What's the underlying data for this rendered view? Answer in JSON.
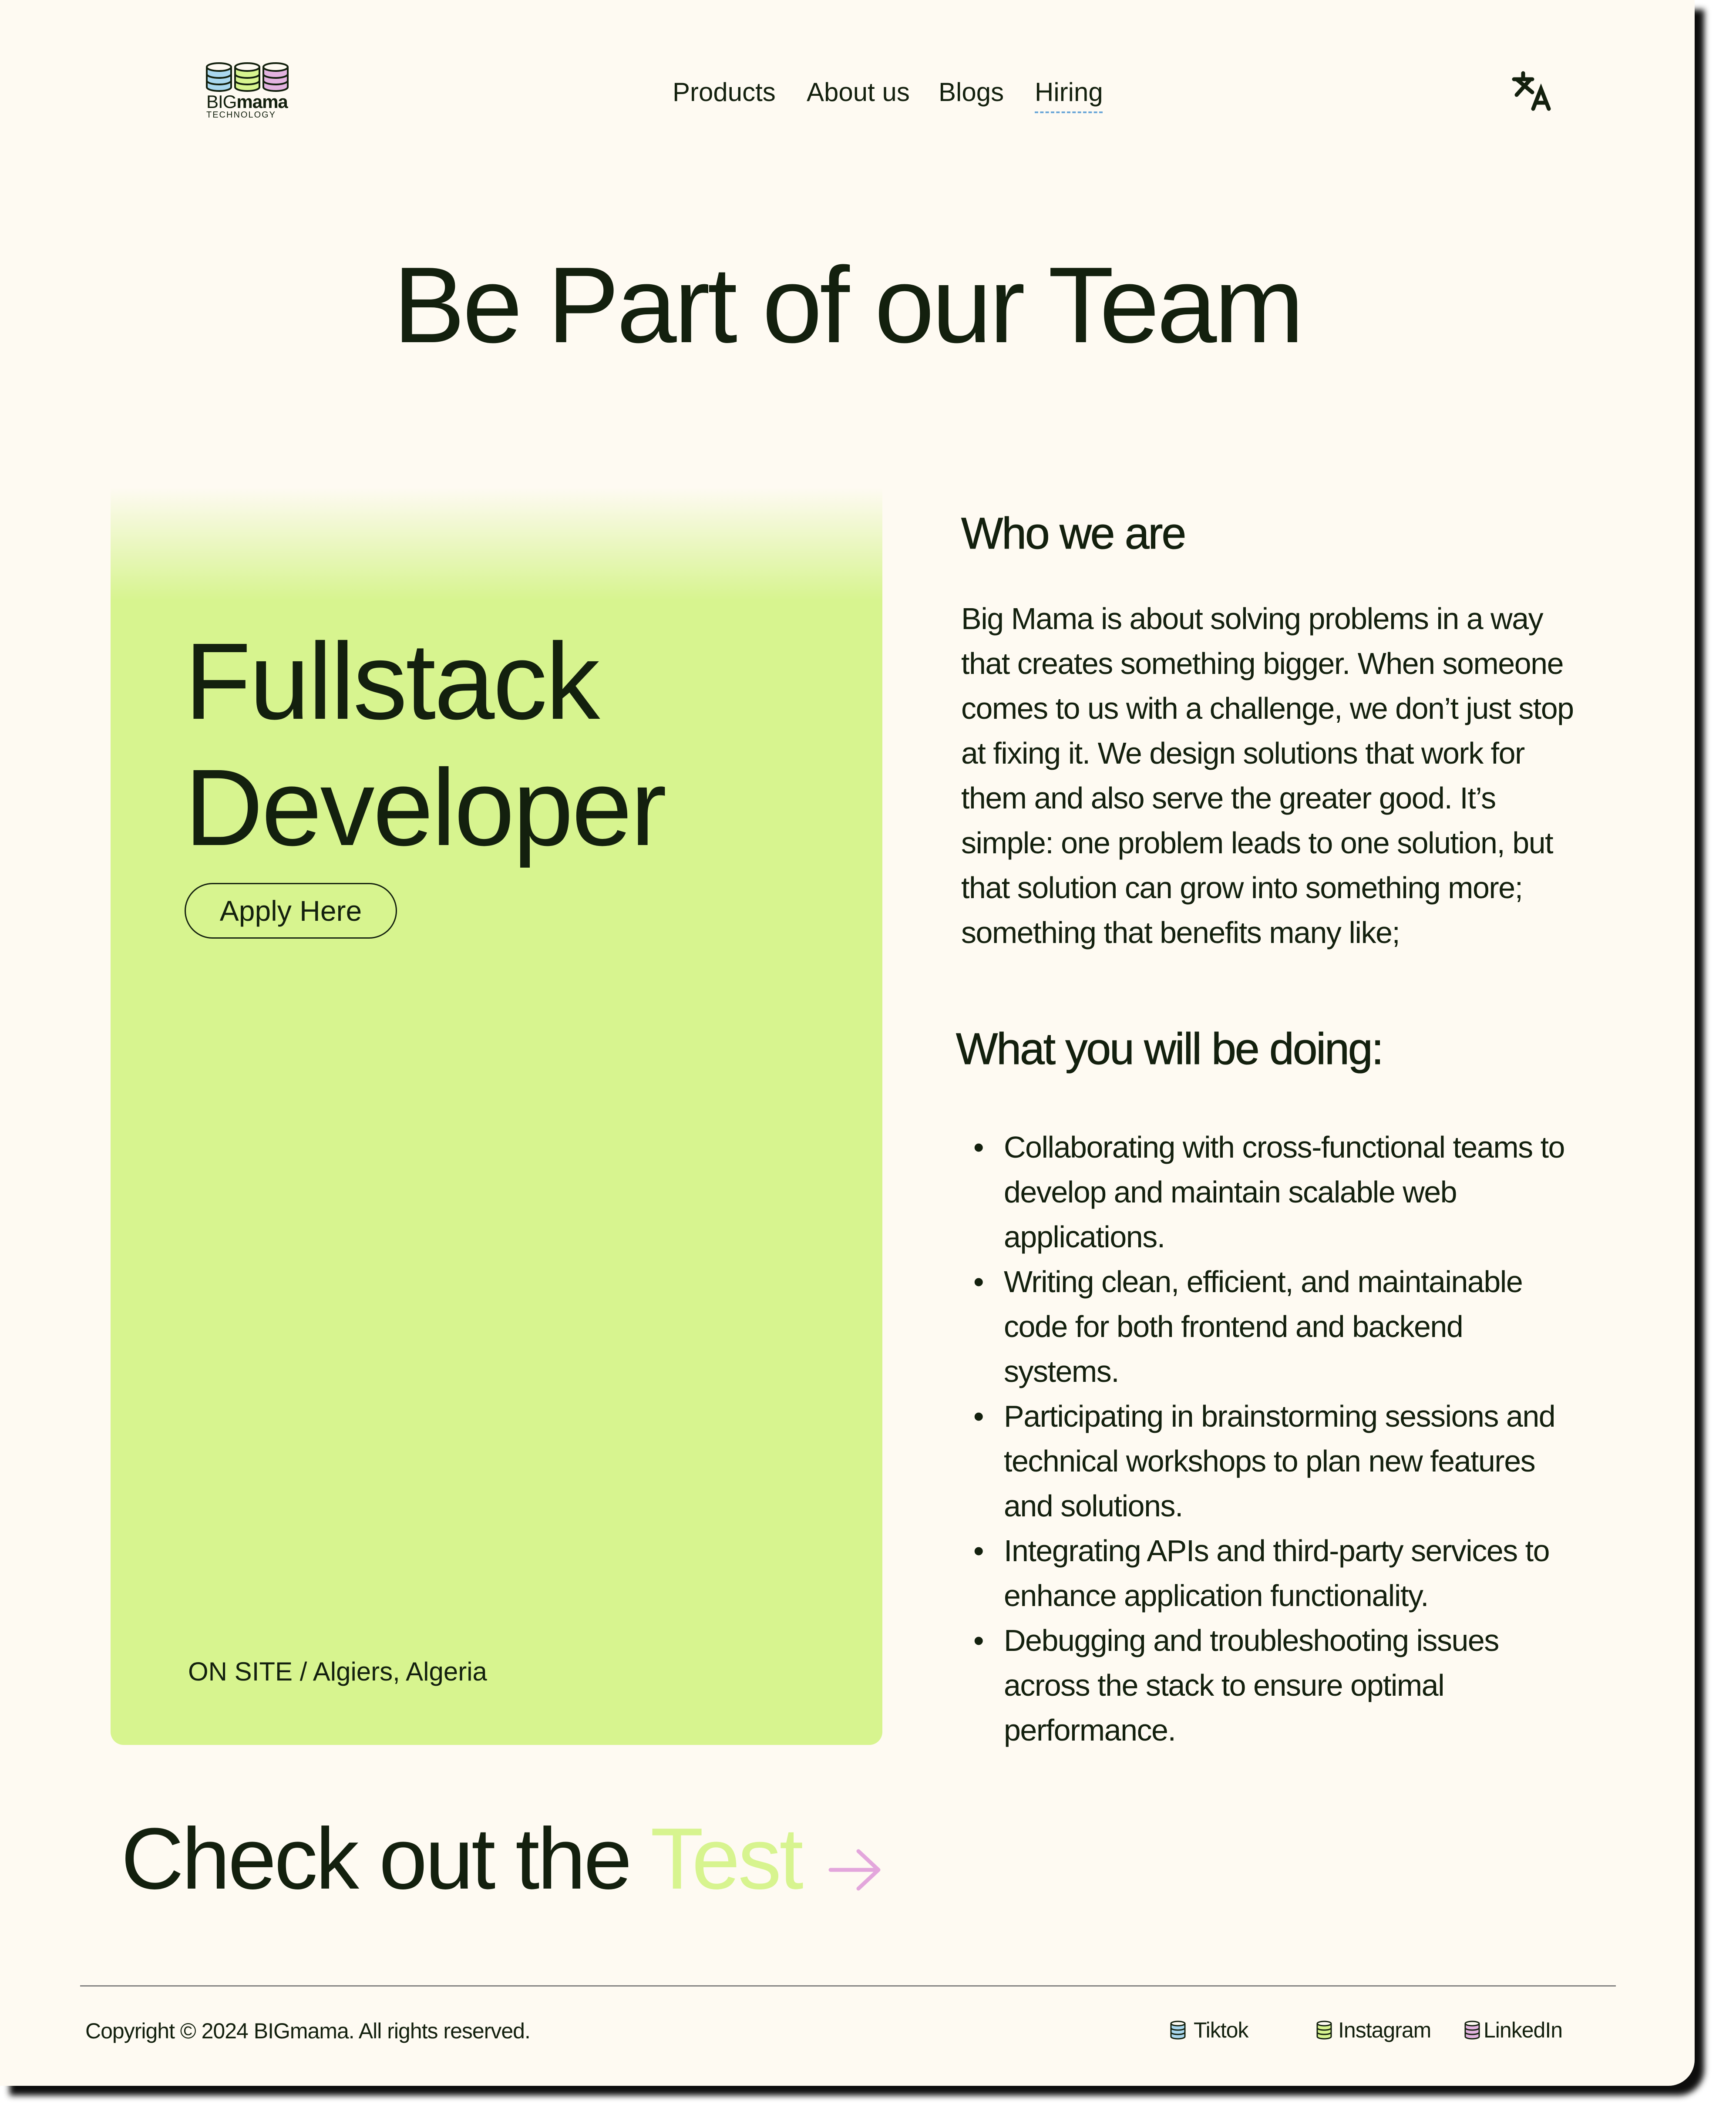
{
  "header": {
    "logo": {
      "brand_light": "BIG",
      "brand_bold": "mama",
      "subtitle": "TECHNOLOGY",
      "icon": "database-stack-logo-icon"
    },
    "nav": [
      {
        "label": "Products"
      },
      {
        "label": "About us"
      },
      {
        "label": "Blogs"
      },
      {
        "label": "Hiring",
        "active": true
      }
    ],
    "language_icon": "translate-icon"
  },
  "hero": {
    "title": "Be Part of our Team"
  },
  "job": {
    "title_line1": "Fullstack",
    "title_line2": "Developer",
    "apply_label": "Apply Here",
    "location": "ON SITE / Algiers, Algeria",
    "card_color": "#d7f48f"
  },
  "about": {
    "heading": "Who we are",
    "text": [
      "Big Mama is about solving problems in a way",
      "that creates something bigger. When someone",
      "comes to us with a challenge, we don’t just stop",
      "at fixing it. We design solutions that work for",
      "them and also serve the greater good. It’s",
      "simple: one problem leads to one solution, but",
      "that solution can grow into something more;",
      "something that benefits many like;"
    ]
  },
  "duties": {
    "heading": "What you will be doing:",
    "items": [
      [
        "Collaborating with cross-functional teams to",
        "develop and maintain scalable web",
        "applications."
      ],
      [
        "Writing clean, efficient, and maintainable",
        "code for both frontend and backend",
        "systems."
      ],
      [
        "Participating in brainstorming sessions and",
        "technical workshops to plan new features",
        "and solutions."
      ],
      [
        "Integrating APIs and third-party services to",
        "enhance application functionality."
      ],
      [
        "Debugging and troubleshooting issues",
        "across the stack to ensure optimal",
        "performance."
      ]
    ]
  },
  "cta": {
    "text": "Check out the ",
    "highlight": "Test",
    "arrow_icon": "arrow-right-icon",
    "highlight_color": "#d7f48f",
    "arrow_color": "#e3a6dc"
  },
  "footer": {
    "copyright": "Copyright © 2024 BIGmama. All rights reserved.",
    "socials": [
      {
        "label": "Tiktok",
        "icon": "database-blue-icon",
        "color": "#a9d7ee"
      },
      {
        "label": "Instagram",
        "icon": "database-green-icon",
        "color": "#d7f48f"
      },
      {
        "label": "LinkedIn",
        "icon": "database-pink-icon",
        "color": "#e3b3e0"
      }
    ]
  }
}
